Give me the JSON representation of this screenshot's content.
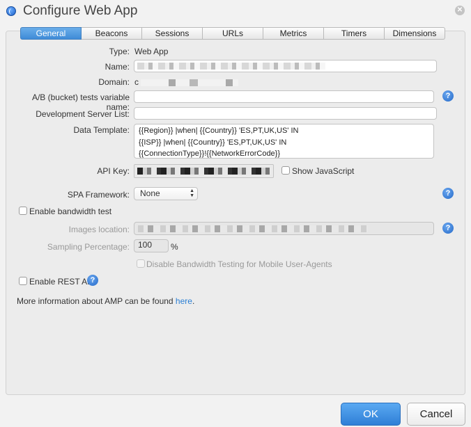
{
  "window": {
    "title": "Configure Web App",
    "app_icon": "globe-icon",
    "close_icon": "close-icon"
  },
  "tabs": [
    {
      "label": "General",
      "active": true
    },
    {
      "label": "Beacons"
    },
    {
      "label": "Sessions"
    },
    {
      "label": "URLs"
    },
    {
      "label": "Metrics"
    },
    {
      "label": "Timers"
    },
    {
      "label": "Dimensions"
    }
  ],
  "form": {
    "type": {
      "label": "Type:",
      "value": "Web App"
    },
    "name": {
      "label": "Name:"
    },
    "domain": {
      "label": "Domain:",
      "value": "c"
    },
    "ab_test": {
      "label": "A/B (bucket) tests variable name:",
      "value": ""
    },
    "dev_server": {
      "label": "Development Server List:",
      "value": ""
    },
    "data_template": {
      "label": "Data Template:",
      "value": "{{Region}} |when| {{Country}} 'ES,PT,UK,US' IN\n{{ISP}} |when| {{Country}} 'ES,PT,UK,US' IN\n{{ConnectionType}}!{{NetworkErrorCode}}"
    },
    "api_key": {
      "label": "API Key:"
    },
    "show_js": {
      "label": "Show JavaScript"
    },
    "spa": {
      "label": "SPA Framework:",
      "value": "None"
    },
    "bandwidth": {
      "label": "Enable bandwidth test"
    },
    "images_location": {
      "label": "Images location:"
    },
    "sampling": {
      "label": "Sampling Percentage:",
      "value": "100",
      "unit": "%"
    },
    "disable_mobile": {
      "label": "Disable Bandwidth Testing for Mobile User-Agents"
    },
    "rest_api": {
      "label": "Enable REST API"
    },
    "info": {
      "text": "More information about AMP can be found ",
      "link": "here",
      "suffix": "."
    }
  },
  "help_symbol": "?",
  "buttons": {
    "ok": "OK",
    "cancel": "Cancel"
  },
  "colors": {
    "accent": "#3f8bd7",
    "link": "#2a7fd4"
  }
}
